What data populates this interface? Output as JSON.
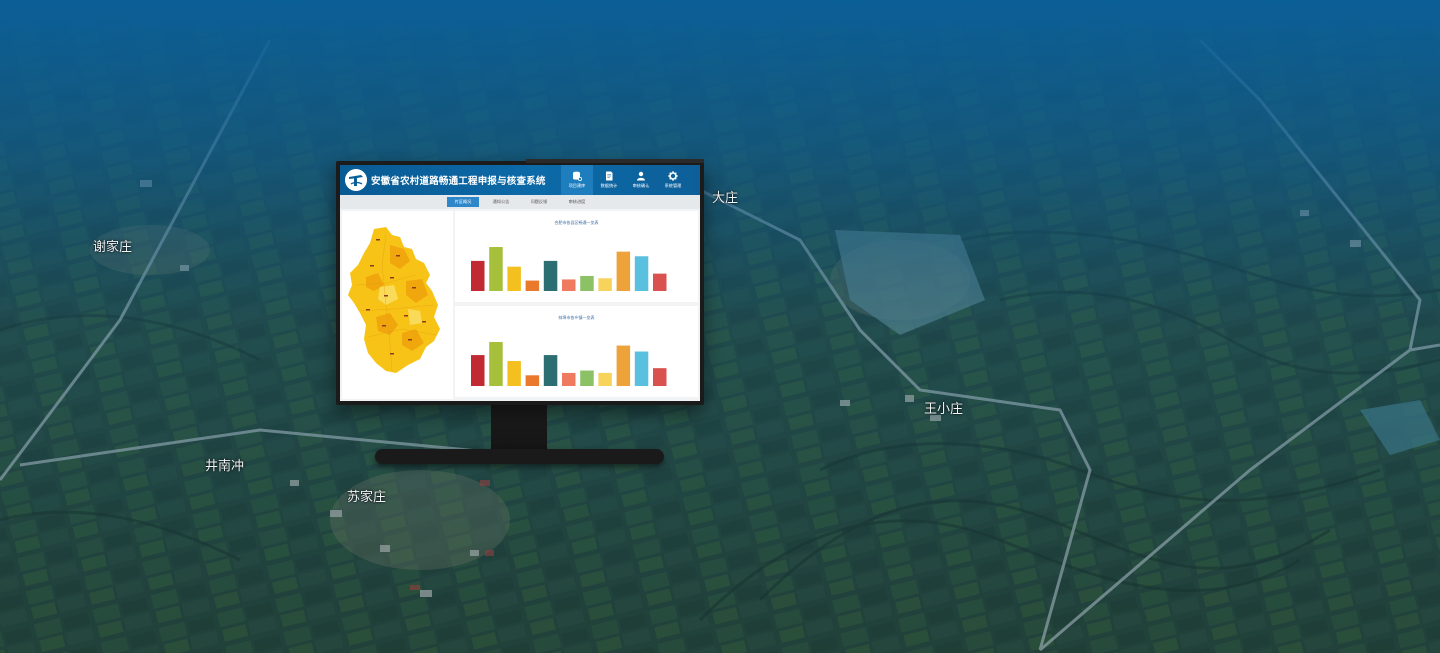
{
  "place_labels": [
    "谢家庄",
    "井南冲",
    "苏家庄",
    "王小庄",
    "大庄"
  ],
  "app": {
    "title": "安徽省农村道路畅通工程申报与核查系统",
    "nav": [
      {
        "label": "项目建库",
        "icon": "database-icon",
        "active": true
      },
      {
        "label": "数据统计",
        "icon": "document-icon",
        "active": false
      },
      {
        "label": "审核确认",
        "icon": "user-icon",
        "active": false
      },
      {
        "label": "系统管理",
        "icon": "gear-icon",
        "active": false
      }
    ],
    "tabs": [
      {
        "label": "片区概况",
        "active": true
      },
      {
        "label": "通知公告",
        "active": false
      },
      {
        "label": "问题反馈",
        "active": false
      },
      {
        "label": "审核进度",
        "active": false
      }
    ]
  },
  "colors": {
    "header": "#0c6aa8",
    "map_fill": "#f7c317",
    "map_dark": "#f0a40c"
  },
  "chart_data": [
    {
      "type": "bar",
      "title": "合肥市各县区畅通一览表",
      "values": [
        26,
        38,
        21,
        9,
        26,
        10,
        13,
        11,
        34,
        30,
        15
      ],
      "colors": [
        "#c22a33",
        "#a7c03c",
        "#f3c020",
        "#e8792d",
        "#2d6e72",
        "#f07a5f",
        "#8cc265",
        "#f7d35c",
        "#eda23a",
        "#5ac0df",
        "#d9524f"
      ]
    },
    {
      "type": "bar",
      "title": "蚌埠市各乡镇一览表",
      "values": [
        26,
        37,
        21,
        9,
        26,
        11,
        13,
        11,
        34,
        29,
        15
      ],
      "colors": [
        "#c22a33",
        "#a7c03c",
        "#f3c020",
        "#e8792d",
        "#2d6e72",
        "#f07a5f",
        "#8cc265",
        "#f7d35c",
        "#eda23a",
        "#5ac0df",
        "#d9524f"
      ]
    }
  ]
}
